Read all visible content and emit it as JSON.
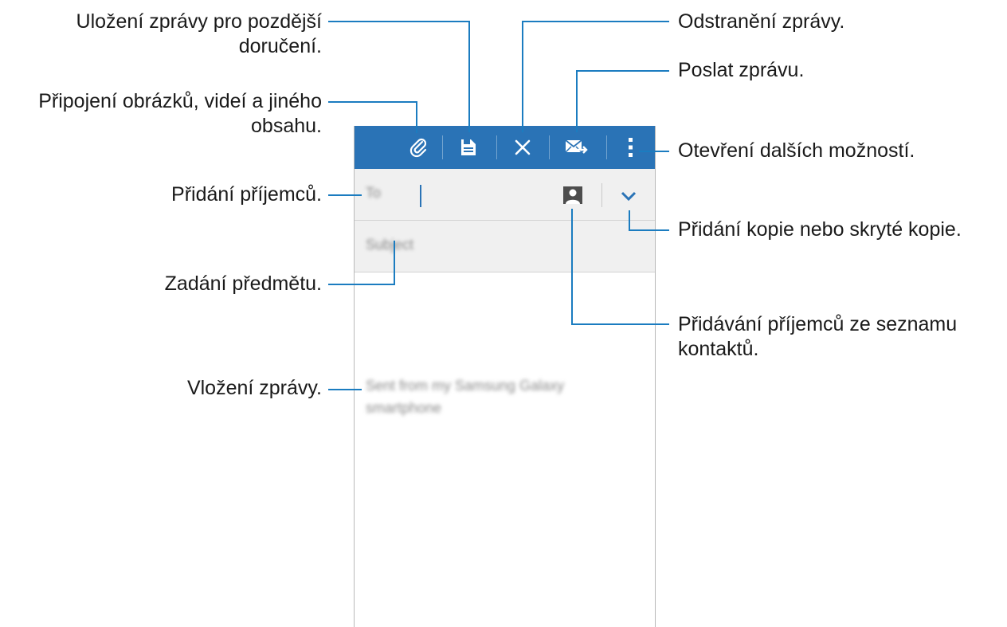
{
  "callouts": {
    "save_draft": "Uložení zprávy pro pozdější doručení.",
    "save_draft_line1": "Uložení zprávy pro pozdější",
    "save_draft_line2": "doručení.",
    "attach_line1": "Připojení obrázků, videí a jiného",
    "attach_line2": "obsahu.",
    "add_recipients": "Přidání příjemců.",
    "enter_subject": "Zadání předmětu.",
    "enter_message": "Vložení zprávy.",
    "delete_message": "Odstranění zprávy.",
    "send_message": "Poslat zprávu.",
    "more_options": "Otevření dalších možností.",
    "cc_bcc": "Přidání kopie nebo skryté kopie.",
    "contacts_line1": "Přidávání příjemců ze seznamu",
    "contacts_line2": "kontaktů."
  },
  "compose": {
    "to_placeholder": "To",
    "subject_placeholder": "Subject",
    "body_text": "Sent from my Samsung Galaxy smartphone"
  },
  "toolbar": {
    "icons": [
      "paperclip-icon",
      "save-icon",
      "close-icon",
      "send-mail-icon",
      "overflow-menu-icon"
    ]
  },
  "colors": {
    "action_bar": "#2a73b6",
    "callout_line": "#1b7cc0"
  }
}
